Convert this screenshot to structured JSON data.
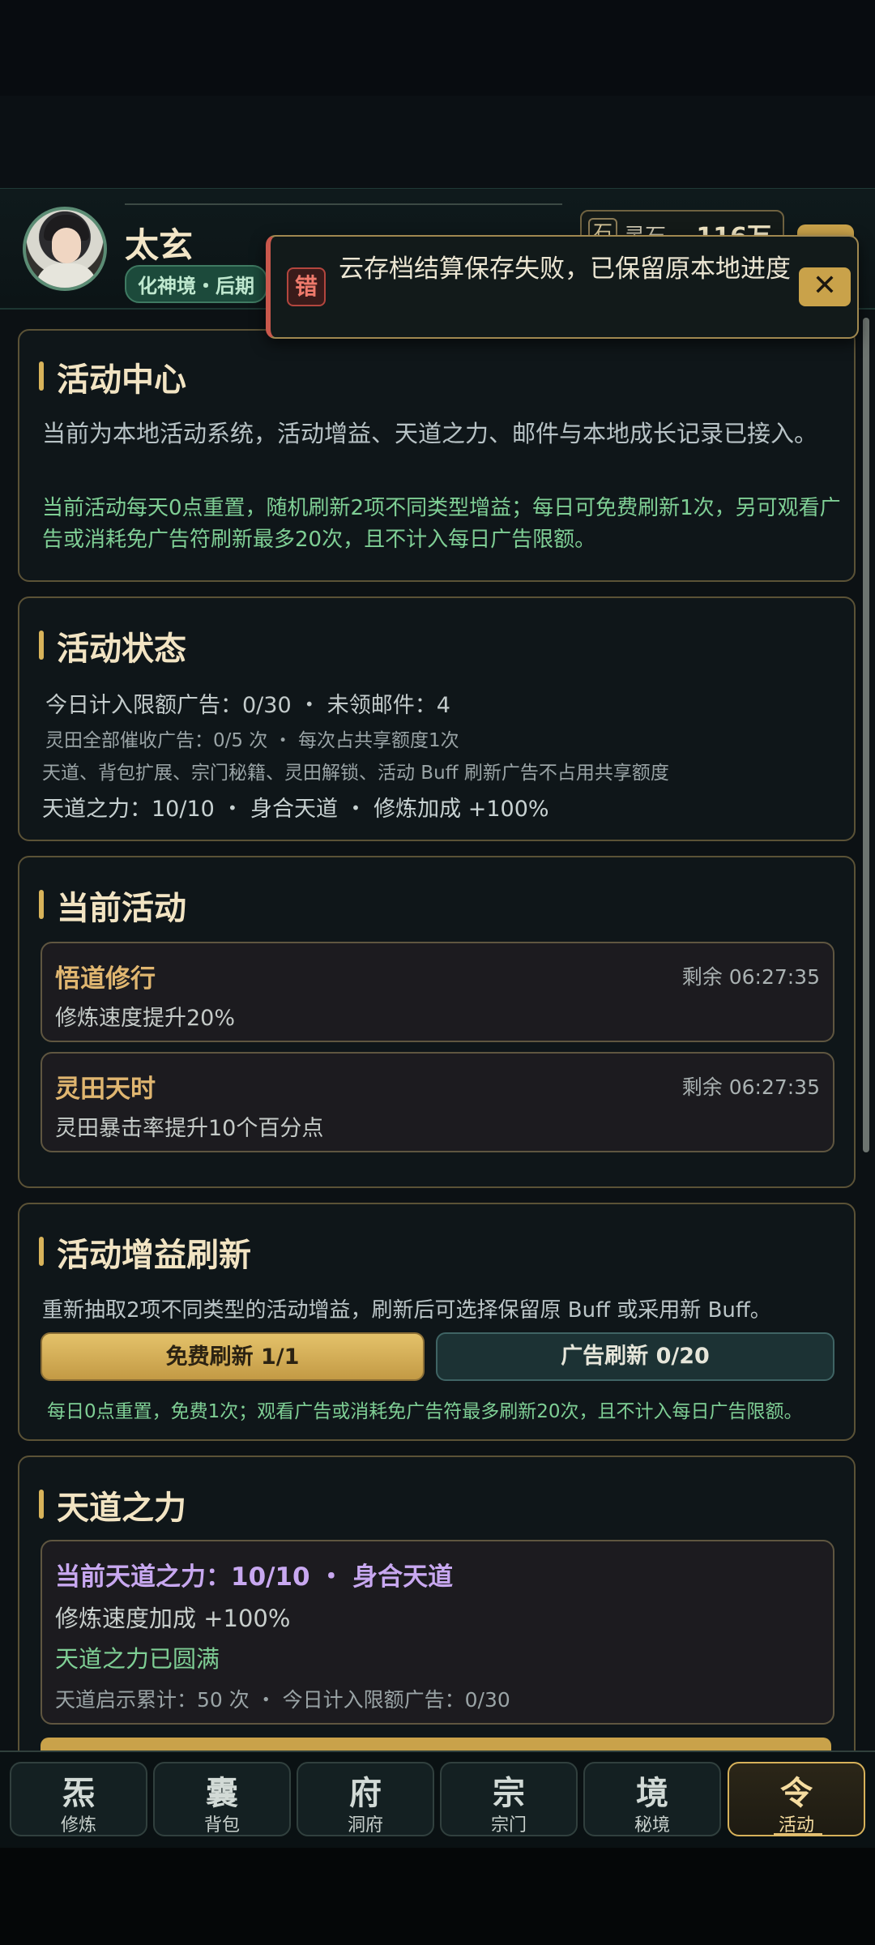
{
  "header": {
    "player_name": "太玄",
    "realm": "化神境・后期",
    "currency_icon": "石",
    "currency_label": "灵石",
    "currency_value": "116万"
  },
  "toast": {
    "badge": "错",
    "message": "云存档结算保存失败，已保留原本地进度",
    "close": "✕"
  },
  "center": {
    "title": "活动中心",
    "description": "当前为本地活动系统，活动增益、天道之力、邮件与本地成长记录已接入。",
    "note": "当前活动每天0点重置，随机刷新2项不同类型增益；每日可免费刷新1次，另可观看广告或消耗免广告符刷新最多20次，且不计入每日广告限额。"
  },
  "status": {
    "title": "活动状态",
    "line1": "今日计入限额广告：0/30 ・ 未领邮件：4",
    "line2": "灵田全部催收广告：0/5 次 ・ 每次占共享额度1次",
    "line3": "天道、背包扩展、宗门秘籍、灵田解锁、活动 Buff 刷新广告不占用共享额度",
    "line4": "天道之力：10/10 ・ 身合天道 ・ 修炼加成 +100%"
  },
  "current": {
    "title": "当前活动",
    "activities": [
      {
        "name": "悟道修行",
        "remain": "剩余 06:27:35",
        "effect": "修炼速度提升20%"
      },
      {
        "name": "灵田天时",
        "remain": "剩余 06:27:35",
        "effect": "灵田暴击率提升10个百分点"
      }
    ]
  },
  "refresh": {
    "title": "活动增益刷新",
    "description": "重新抽取2项不同类型的活动增益，刷新后可选择保留原 Buff 或采用新 Buff。",
    "free_button": "免费刷新 1/1",
    "ad_button": "广告刷新 0/20",
    "note": "每日0点重置，免费1次；观看广告或消耗免广告符最多刷新20次，且不计入每日广告限额。"
  },
  "tiandao": {
    "title": "天道之力",
    "headline": "当前天道之力：10/10 ・ 身合天道",
    "bonus": "修炼速度加成 +100%",
    "state": "天道之力已圆满",
    "stats": "天道启示累计：50 次 ・ 今日计入限额广告：0/30"
  },
  "nav": [
    {
      "glyph": "炁",
      "label": "修炼"
    },
    {
      "glyph": "囊",
      "label": "背包"
    },
    {
      "glyph": "府",
      "label": "洞府"
    },
    {
      "glyph": "宗",
      "label": "宗门"
    },
    {
      "glyph": "境",
      "label": "秘境"
    },
    {
      "glyph": "令",
      "label": "活动"
    }
  ],
  "colors": {
    "accent_gold": "#d8b35a",
    "error_red": "#c9584c",
    "positive_green": "#7fcf95",
    "tiandao_purple": "#c8a8f0"
  }
}
